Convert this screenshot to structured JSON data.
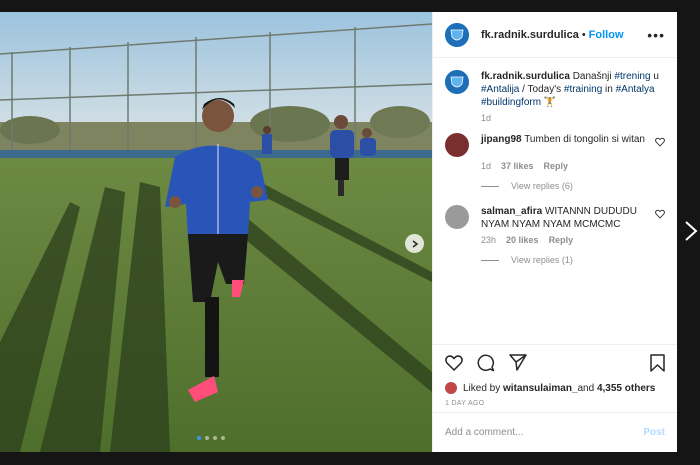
{
  "post": {
    "account": "fk.radnik.surdulica",
    "separator": "•",
    "follow_label": "Follow",
    "more_icon": "more-horizontal-icon",
    "caption": {
      "user": "fk.radnik.surdulica",
      "parts": [
        {
          "t": "Današnji ",
          "tag": false
        },
        {
          "t": "#trening",
          "tag": true
        },
        {
          "t": " u ",
          "tag": false
        },
        {
          "t": "#Antalija",
          "tag": true
        },
        {
          "t": " / Today's ",
          "tag": false
        },
        {
          "t": "#training",
          "tag": true
        },
        {
          "t": " in ",
          "tag": false
        },
        {
          "t": "#Antalya",
          "tag": true
        },
        {
          "t": " ",
          "tag": false
        },
        {
          "t": "#buildingform",
          "tag": true
        },
        {
          "t": " 🏋",
          "tag": false
        }
      ],
      "time": "1d"
    },
    "comments": [
      {
        "user": "jipang98",
        "text": "Tumben di tongolin si witan",
        "time": "1d",
        "likes": "37 likes",
        "reply": "Reply",
        "view_replies": "View replies (6)",
        "avatar_color": "#7a2e2e"
      },
      {
        "user": "salman_afira",
        "text": "WITANNN DUDUDU NYAM NYAM NYAM MCMCMC",
        "time": "23h",
        "likes": "20 likes",
        "reply": "Reply",
        "view_replies": "View replies (1)",
        "avatar_color": "#9a9a9a"
      }
    ],
    "likes": {
      "prefix": "Liked by ",
      "user": "witansulaiman_",
      "suffix": " and ",
      "others": "4,355 others"
    },
    "posted_ago": "1 DAY AGO",
    "comment_input": {
      "placeholder": "Add a comment...",
      "post_label": "Post"
    },
    "carousel": {
      "count": 4,
      "active": 0
    },
    "colors": {
      "accent": "#0095f6",
      "hashtag": "#00376b",
      "muted": "#8e8e8e"
    }
  }
}
